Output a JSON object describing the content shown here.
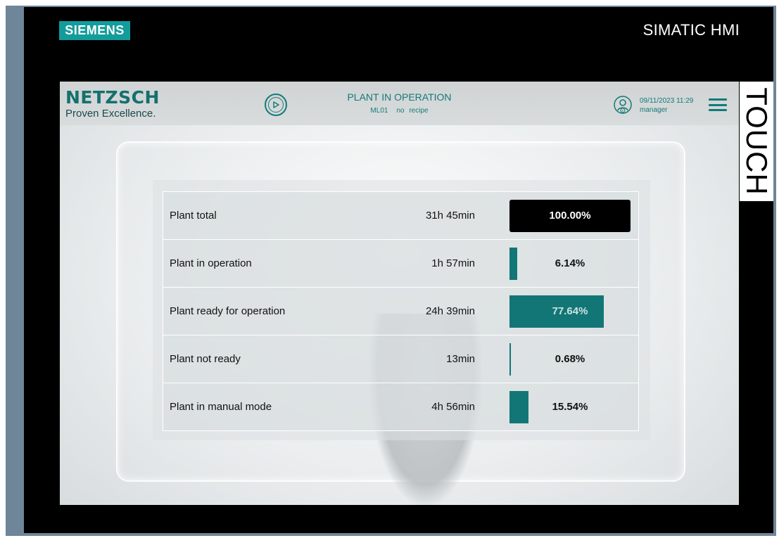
{
  "device": {
    "brand": "SIEMENS",
    "product": "SIMATIC HMI",
    "side_label": "TOUCH"
  },
  "header": {
    "logo": "NETZSCH",
    "tagline": "Proven Excellence.",
    "status_title": "PLANT IN OPERATION",
    "machine": "ML01",
    "recipe": "no recipe",
    "datetime": "09/11/2023 11:29",
    "user": "manager",
    "play_icon": "play-circle-icon",
    "user_icon": "user-icon",
    "menu_icon": "hamburger-menu-icon"
  },
  "colors": {
    "accent": "#137a78",
    "bar": "#127676",
    "total_bar": "#000000"
  },
  "rows": [
    {
      "label": "Plant total",
      "duration": "31h 45min",
      "percent_text": "100.00%",
      "fraction": 1.0,
      "style": "black"
    },
    {
      "label": "Plant in operation",
      "duration": "1h 57min",
      "percent_text": "6.14%",
      "fraction": 0.0614,
      "style": "teal"
    },
    {
      "label": "Plant ready for operation",
      "duration": "24h 39min",
      "percent_text": "77.64%",
      "fraction": 0.7764,
      "style": "teal"
    },
    {
      "label": "Plant not ready",
      "duration": "13min",
      "percent_text": "0.68%",
      "fraction": 0.0068,
      "style": "teal"
    },
    {
      "label": "Plant in manual mode",
      "duration": "4h 56min",
      "percent_text": "15.54%",
      "fraction": 0.1554,
      "style": "teal"
    }
  ]
}
